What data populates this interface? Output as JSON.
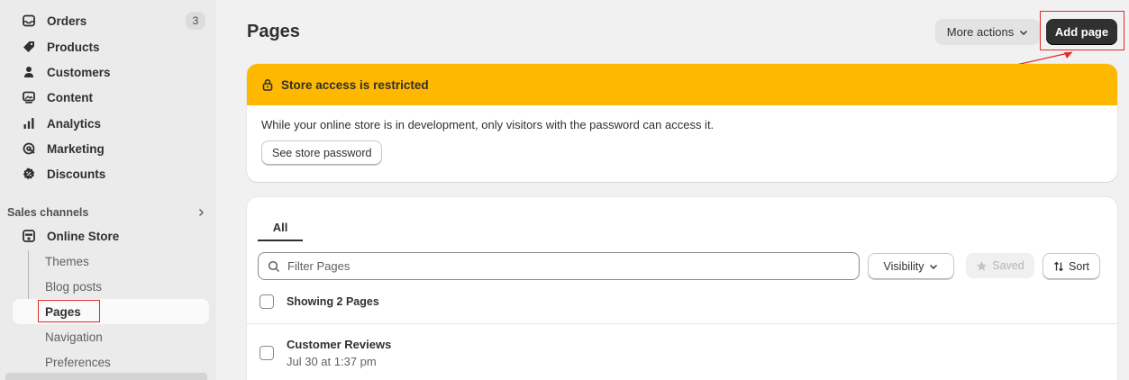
{
  "sidebar": {
    "items": [
      {
        "label": "Orders",
        "icon": "inbox-icon",
        "badge": "3"
      },
      {
        "label": "Products",
        "icon": "tag-icon"
      },
      {
        "label": "Customers",
        "icon": "person-icon"
      },
      {
        "label": "Content",
        "icon": "image-icon"
      },
      {
        "label": "Analytics",
        "icon": "bar-chart-icon"
      },
      {
        "label": "Marketing",
        "icon": "target-icon"
      },
      {
        "label": "Discounts",
        "icon": "discount-icon"
      }
    ],
    "section_title": "Sales channels",
    "channel": {
      "label": "Online Store",
      "icon": "store-icon"
    },
    "sub_items": [
      {
        "label": "Themes"
      },
      {
        "label": "Blog posts"
      },
      {
        "label": "Pages",
        "active": true
      },
      {
        "label": "Navigation"
      },
      {
        "label": "Preferences"
      }
    ]
  },
  "header": {
    "title": "Pages",
    "more_actions_label": "More actions",
    "add_page_label": "Add page"
  },
  "banner": {
    "title": "Store access is restricted",
    "message": "While your online store is in development, only visitors with the password can access it.",
    "button_label": "See store password",
    "color": "#ffb800"
  },
  "list": {
    "tab_all": "All",
    "filter_placeholder": "Filter Pages",
    "visibility_label": "Visibility",
    "saved_label": "Saved",
    "sort_label": "Sort",
    "showing_label": "Showing 2 Pages",
    "rows": [
      {
        "title": "Customer Reviews",
        "date": "Jul 30 at 1:37 pm"
      }
    ]
  },
  "colors": {
    "annotation": "#e12a2a",
    "primary_button": "#303030"
  }
}
